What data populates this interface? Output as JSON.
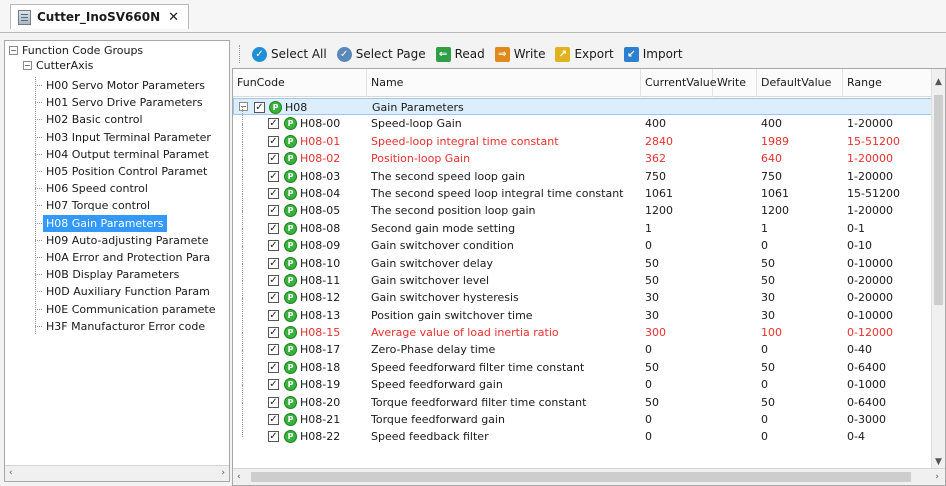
{
  "tab": {
    "title": "Cutter_InoSV660N",
    "close": "✕",
    "icon": "document-icon"
  },
  "tree": {
    "root_label": "Function Code Groups",
    "axis_label": "CutterAxis",
    "items": [
      {
        "label": "H00 Servo Motor Parameters",
        "selected": false
      },
      {
        "label": "H01 Servo Drive Parameters",
        "selected": false
      },
      {
        "label": "H02 Basic control",
        "selected": false
      },
      {
        "label": "H03 Input Terminal Parameter",
        "selected": false
      },
      {
        "label": "H04 Output terminal Paramet",
        "selected": false
      },
      {
        "label": "H05 Position Control Paramet",
        "selected": false
      },
      {
        "label": "H06 Speed control",
        "selected": false
      },
      {
        "label": "H07 Torque control",
        "selected": false
      },
      {
        "label": "H08 Gain Parameters",
        "selected": true
      },
      {
        "label": "H09 Auto-adjusting Paramete",
        "selected": false
      },
      {
        "label": "H0A Error and Protection Para",
        "selected": false
      },
      {
        "label": "H0B Display Parameters",
        "selected": false
      },
      {
        "label": "H0D Auxiliary Function Param",
        "selected": false
      },
      {
        "label": "H0E Communication paramete",
        "selected": false
      },
      {
        "label": "H3F Manufacturor Error code",
        "selected": false
      }
    ]
  },
  "toolbar": {
    "select_all": "Select All",
    "select_page": "Select Page",
    "read": "Read",
    "write": "Write",
    "export": "Export",
    "import": "Import"
  },
  "table": {
    "headers": {
      "funcode": "FunCode",
      "name": "Name",
      "current": "CurrentValue",
      "write": "Write",
      "default": "DefaultValue",
      "range": "Range"
    },
    "group": {
      "code": "H08",
      "name": "Gain Parameters"
    },
    "rows": [
      {
        "code": "H08-00",
        "name": "Speed-loop Gain",
        "current": "400",
        "default": "400",
        "range": "1-20000",
        "red": false
      },
      {
        "code": "H08-01",
        "name": "Speed-loop integral time constant",
        "current": "2840",
        "default": "1989",
        "range": "15-51200",
        "red": true
      },
      {
        "code": "H08-02",
        "name": "Position-loop Gain",
        "current": "362",
        "default": "640",
        "range": "1-20000",
        "red": true
      },
      {
        "code": "H08-03",
        "name": "The second speed loop gain",
        "current": "750",
        "default": "750",
        "range": "1-20000",
        "red": false
      },
      {
        "code": "H08-04",
        "name": "The second speed loop integral time constant",
        "current": "1061",
        "default": "1061",
        "range": "15-51200",
        "red": false
      },
      {
        "code": "H08-05",
        "name": "The second position loop gain",
        "current": "1200",
        "default": "1200",
        "range": "1-20000",
        "red": false
      },
      {
        "code": "H08-08",
        "name": "Second gain mode setting",
        "current": "1",
        "default": "1",
        "range": "0-1",
        "red": false
      },
      {
        "code": "H08-09",
        "name": "Gain switchover condition",
        "current": "0",
        "default": "0",
        "range": "0-10",
        "red": false
      },
      {
        "code": "H08-10",
        "name": "Gain switchover delay",
        "current": "50",
        "default": "50",
        "range": "0-10000",
        "red": false
      },
      {
        "code": "H08-11",
        "name": "Gain switchover level",
        "current": "50",
        "default": "50",
        "range": "0-20000",
        "red": false
      },
      {
        "code": "H08-12",
        "name": "Gain switchover hysteresis",
        "current": "30",
        "default": "30",
        "range": "0-20000",
        "red": false
      },
      {
        "code": "H08-13",
        "name": "Position gain switchover time",
        "current": "30",
        "default": "30",
        "range": "0-10000",
        "red": false
      },
      {
        "code": "H08-15",
        "name": "Average value of load inertia ratio",
        "current": "300",
        "default": "100",
        "range": "0-12000",
        "red": true
      },
      {
        "code": "H08-17",
        "name": "Zero-Phase delay time",
        "current": "0",
        "default": "0",
        "range": "0-40",
        "red": false
      },
      {
        "code": "H08-18",
        "name": "Speed feedforward filter time constant",
        "current": "50",
        "default": "50",
        "range": "0-6400",
        "red": false
      },
      {
        "code": "H08-19",
        "name": "Speed feedforward gain",
        "current": "0",
        "default": "0",
        "range": "0-1000",
        "red": false
      },
      {
        "code": "H08-20",
        "name": "Torque feedforward filter time constant",
        "current": "50",
        "default": "50",
        "range": "0-6400",
        "red": false
      },
      {
        "code": "H08-21",
        "name": "Torque feedforward gain",
        "current": "0",
        "default": "0",
        "range": "0-3000",
        "red": false
      },
      {
        "code": "H08-22",
        "name": "Speed feedback filter",
        "current": "0",
        "default": "0",
        "range": "0-4",
        "red": false
      }
    ]
  },
  "colors": {
    "selection": "#3399ff",
    "modified_text": "#e8312f",
    "group_row": "#dceefc",
    "param_icon": "#37b33b"
  }
}
